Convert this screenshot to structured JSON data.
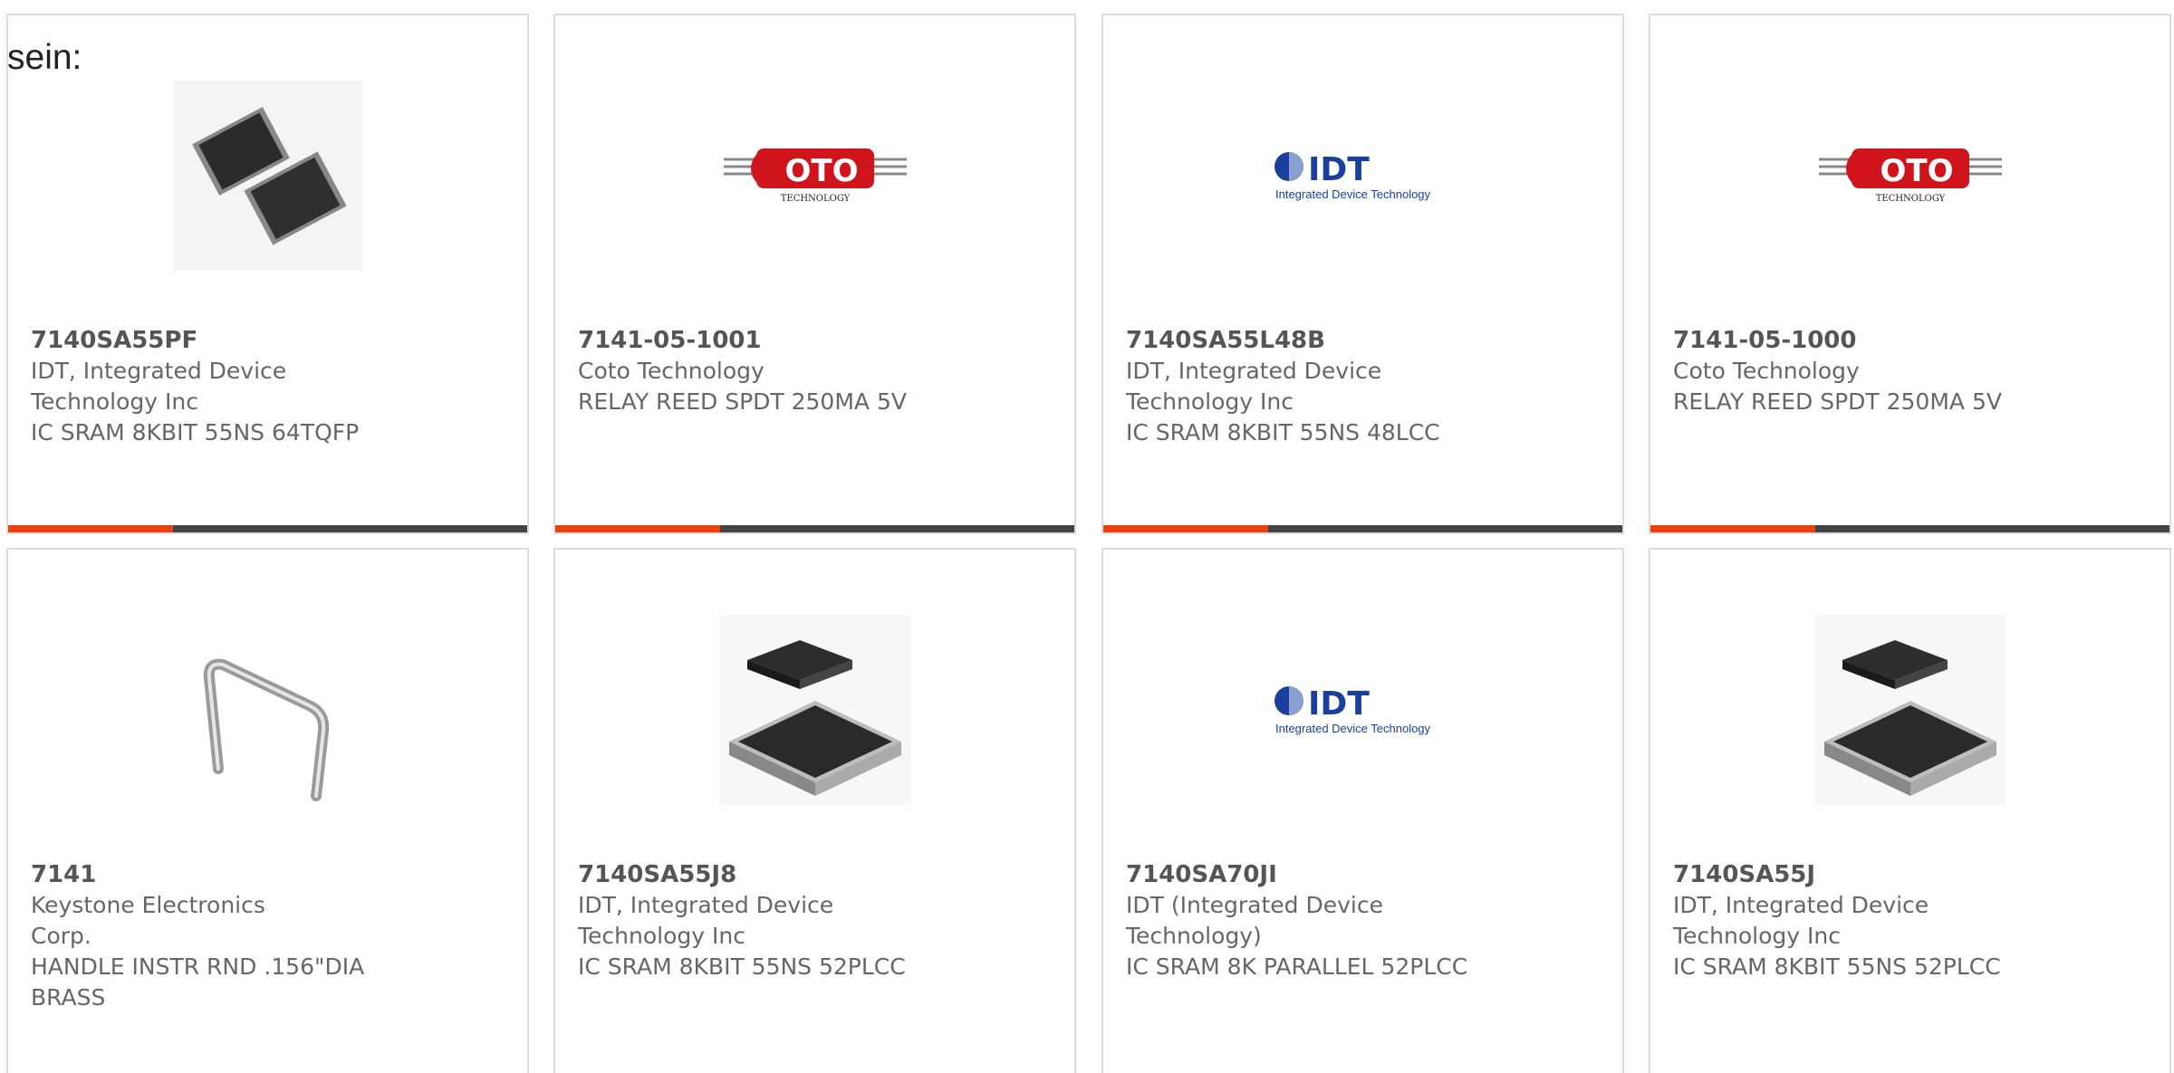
{
  "intro_text": "sein:",
  "colors": {
    "accent": "#e8430f",
    "bar": "#444444",
    "idt_blue": "#1a3f9c",
    "coto_red": "#d0141c"
  },
  "products": [
    {
      "part_number": "7140SA55PF",
      "manufacturer": "IDT, Integrated Device Technology Inc",
      "description": "IC SRAM 8KBIT 55NS 64TQFP",
      "image": "tqfp-chip-image"
    },
    {
      "part_number": "7141-05-1001",
      "manufacturer": "Coto Technology",
      "description": "RELAY REED SPDT 250MA 5V",
      "image": "coto-logo",
      "logo_text": "OTO",
      "logo_sub": "TECHNOLOGY"
    },
    {
      "part_number": "7140SA55L48B",
      "manufacturer": "IDT, Integrated Device Technology Inc",
      "description": "IC SRAM 8KBIT 55NS 48LCC",
      "image": "idt-logo",
      "logo_text": "IDT",
      "logo_sub": "Integrated Device Technology"
    },
    {
      "part_number": "7141-05-1000",
      "manufacturer": "Coto Technology",
      "description": "RELAY REED SPDT 250MA 5V",
      "image": "coto-logo",
      "logo_text": "OTO",
      "logo_sub": "TECHNOLOGY"
    },
    {
      "part_number": "7141",
      "manufacturer": "Keystone Electronics Corp.",
      "description": "HANDLE INSTR RND .156\"DIA BRASS",
      "image": "handle-image"
    },
    {
      "part_number": "7140SA55J8",
      "manufacturer": "IDT, Integrated Device Technology Inc",
      "description": "IC SRAM 8KBIT 55NS 52PLCC",
      "image": "plcc-chip-image"
    },
    {
      "part_number": "7140SA70JI",
      "manufacturer": "IDT (Integrated Device Technology)",
      "description": "IC SRAM 8K PARALLEL 52PLCC",
      "image": "idt-logo",
      "logo_text": "IDT",
      "logo_sub": "Integrated Device Technology"
    },
    {
      "part_number": "7140SA55J",
      "manufacturer": "IDT, Integrated Device Technology Inc",
      "description": "IC SRAM 8KBIT 55NS 52PLCC",
      "image": "plcc-chip-image"
    }
  ]
}
